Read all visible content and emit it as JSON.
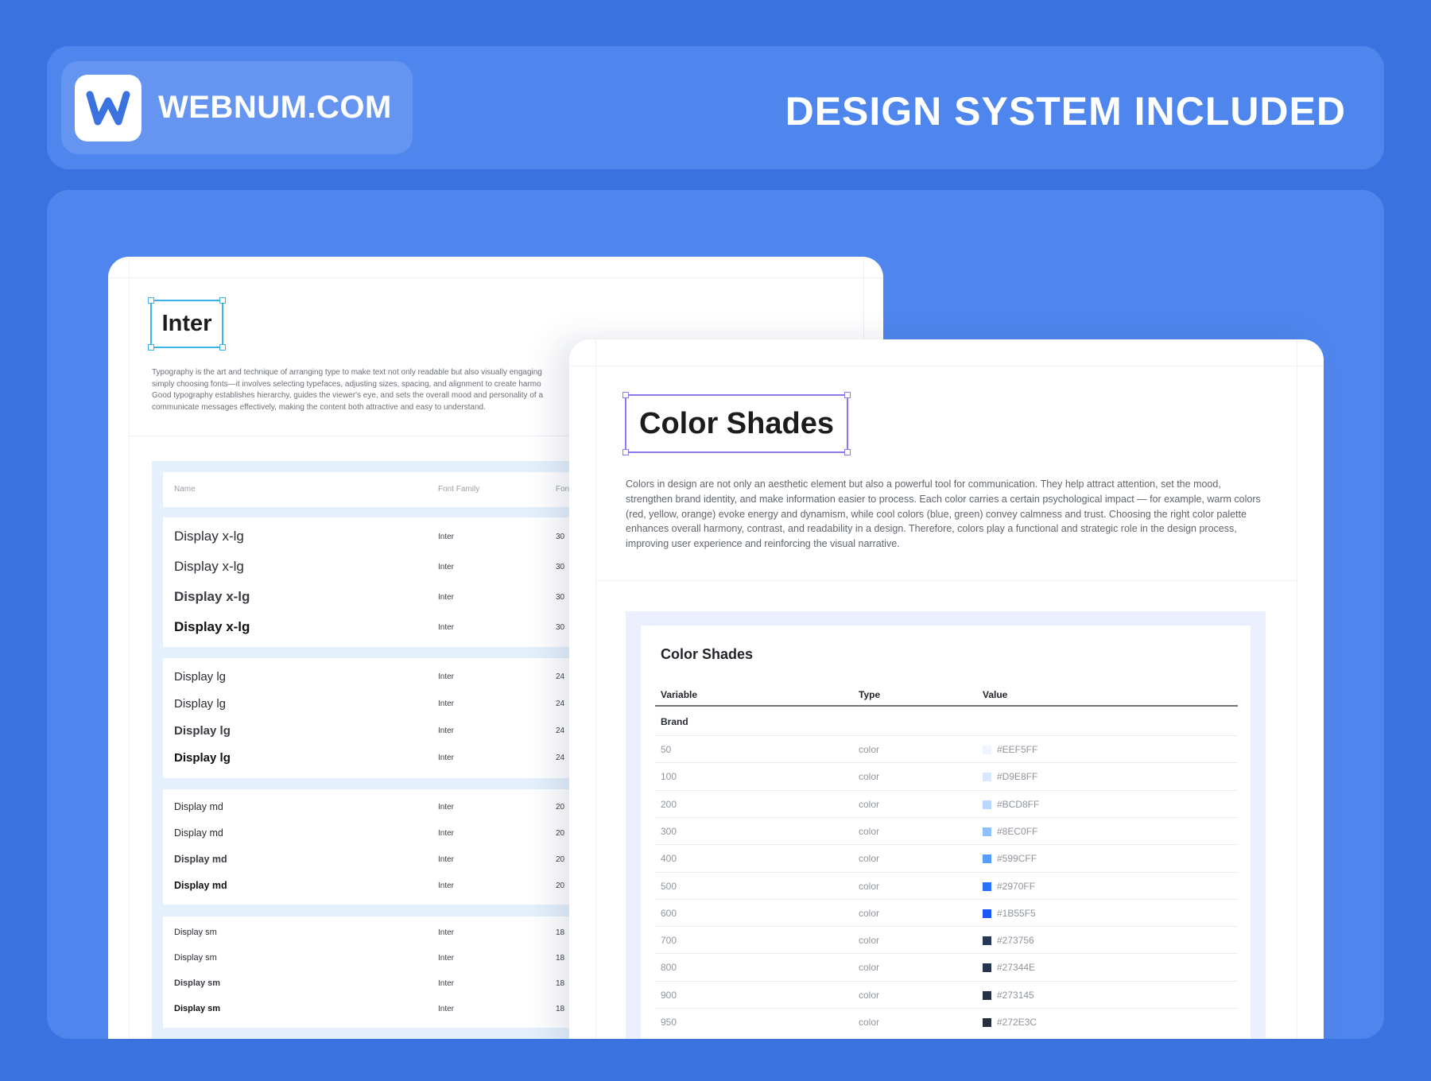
{
  "header": {
    "brand": "WEBNUM.COM",
    "logo_letter": "w",
    "title": "DESIGN SYSTEM INCLUDED",
    "logo_color": "#3A72E0"
  },
  "typography_card": {
    "title": "Inter",
    "description": [
      "Typography is the art and technique of arranging type to make text not only readable but also visually engaging",
      "simply choosing fonts—it involves selecting typefaces, adjusting sizes, spacing, and alignment to create harmo",
      "Good typography establishes hierarchy, guides the viewer's eye, and sets the overall mood and personality of a",
      "communicate messages effectively, making the content both attractive and easy to understand."
    ],
    "columns": [
      "Name",
      "Font Family",
      "Fon"
    ],
    "groups": [
      {
        "rows": [
          {
            "name": "Display x-lg",
            "family": "Inter",
            "size": "30"
          },
          {
            "name": "Display x-lg",
            "family": "Inter",
            "size": "30"
          },
          {
            "name": "Display x-lg",
            "family": "Inter",
            "size": "30"
          },
          {
            "name": "Display x-lg",
            "family": "Inter",
            "size": "30"
          }
        ]
      },
      {
        "rows": [
          {
            "name": "Display lg",
            "family": "Inter",
            "size": "24"
          },
          {
            "name": "Display lg",
            "family": "Inter",
            "size": "24"
          },
          {
            "name": "Display lg",
            "family": "Inter",
            "size": "24"
          },
          {
            "name": "Display lg",
            "family": "Inter",
            "size": "24"
          }
        ]
      },
      {
        "rows": [
          {
            "name": "Display md",
            "family": "Inter",
            "size": "20"
          },
          {
            "name": "Display md",
            "family": "Inter",
            "size": "20"
          },
          {
            "name": "Display md",
            "family": "Inter",
            "size": "20"
          },
          {
            "name": "Display md",
            "family": "Inter",
            "size": "20"
          }
        ]
      },
      {
        "rows": [
          {
            "name": "Display sm",
            "family": "Inter",
            "size": "18"
          },
          {
            "name": "Display sm",
            "family": "Inter",
            "size": "18"
          },
          {
            "name": "Display sm",
            "family": "Inter",
            "size": "18"
          },
          {
            "name": "Display sm",
            "family": "Inter",
            "size": "18"
          }
        ]
      }
    ]
  },
  "color_card": {
    "title": "Color Shades",
    "description": "Colors in design are not only an aesthetic element but also a powerful tool for communication. They help attract attention, set the mood, strengthen brand identity, and make information easier to process. Each color carries a certain psychological impact — for example, warm colors (red, yellow, orange) evoke energy and dynamism, while cool colors (blue, green) convey calmness and trust. Choosing the right color palette enhances overall harmony, contrast, and readability in a design. Therefore, colors play a functional and strategic role in the design process, improving user experience and reinforcing the visual narrative.",
    "table_title": "Color Shades",
    "columns": [
      "Variable",
      "Type",
      "Value"
    ],
    "group": "Brand",
    "rows": [
      {
        "variable": "50",
        "type": "color",
        "value": "#EEF5FF",
        "swatch": "#EEF5FF"
      },
      {
        "variable": "100",
        "type": "color",
        "value": "#D9E8FF",
        "swatch": "#D9E8FF"
      },
      {
        "variable": "200",
        "type": "color",
        "value": "#BCD8FF",
        "swatch": "#BCD8FF"
      },
      {
        "variable": "300",
        "type": "color",
        "value": "#8EC0FF",
        "swatch": "#8EC0FF"
      },
      {
        "variable": "400",
        "type": "color",
        "value": "#599CFF",
        "swatch": "#599CFF"
      },
      {
        "variable": "500",
        "type": "color",
        "value": "#2970FF",
        "swatch": "#2970FF"
      },
      {
        "variable": "600",
        "type": "color",
        "value": "#1B55F5",
        "swatch": "#1B55F5"
      },
      {
        "variable": "700",
        "type": "color",
        "value": "#273756",
        "swatch": "#273756"
      },
      {
        "variable": "800",
        "type": "color",
        "value": "#27344E",
        "swatch": "#27344E"
      },
      {
        "variable": "900",
        "type": "color",
        "value": "#273145",
        "swatch": "#273145"
      },
      {
        "variable": "950",
        "type": "color",
        "value": "#272E3C",
        "swatch": "#272E3C"
      }
    ]
  }
}
